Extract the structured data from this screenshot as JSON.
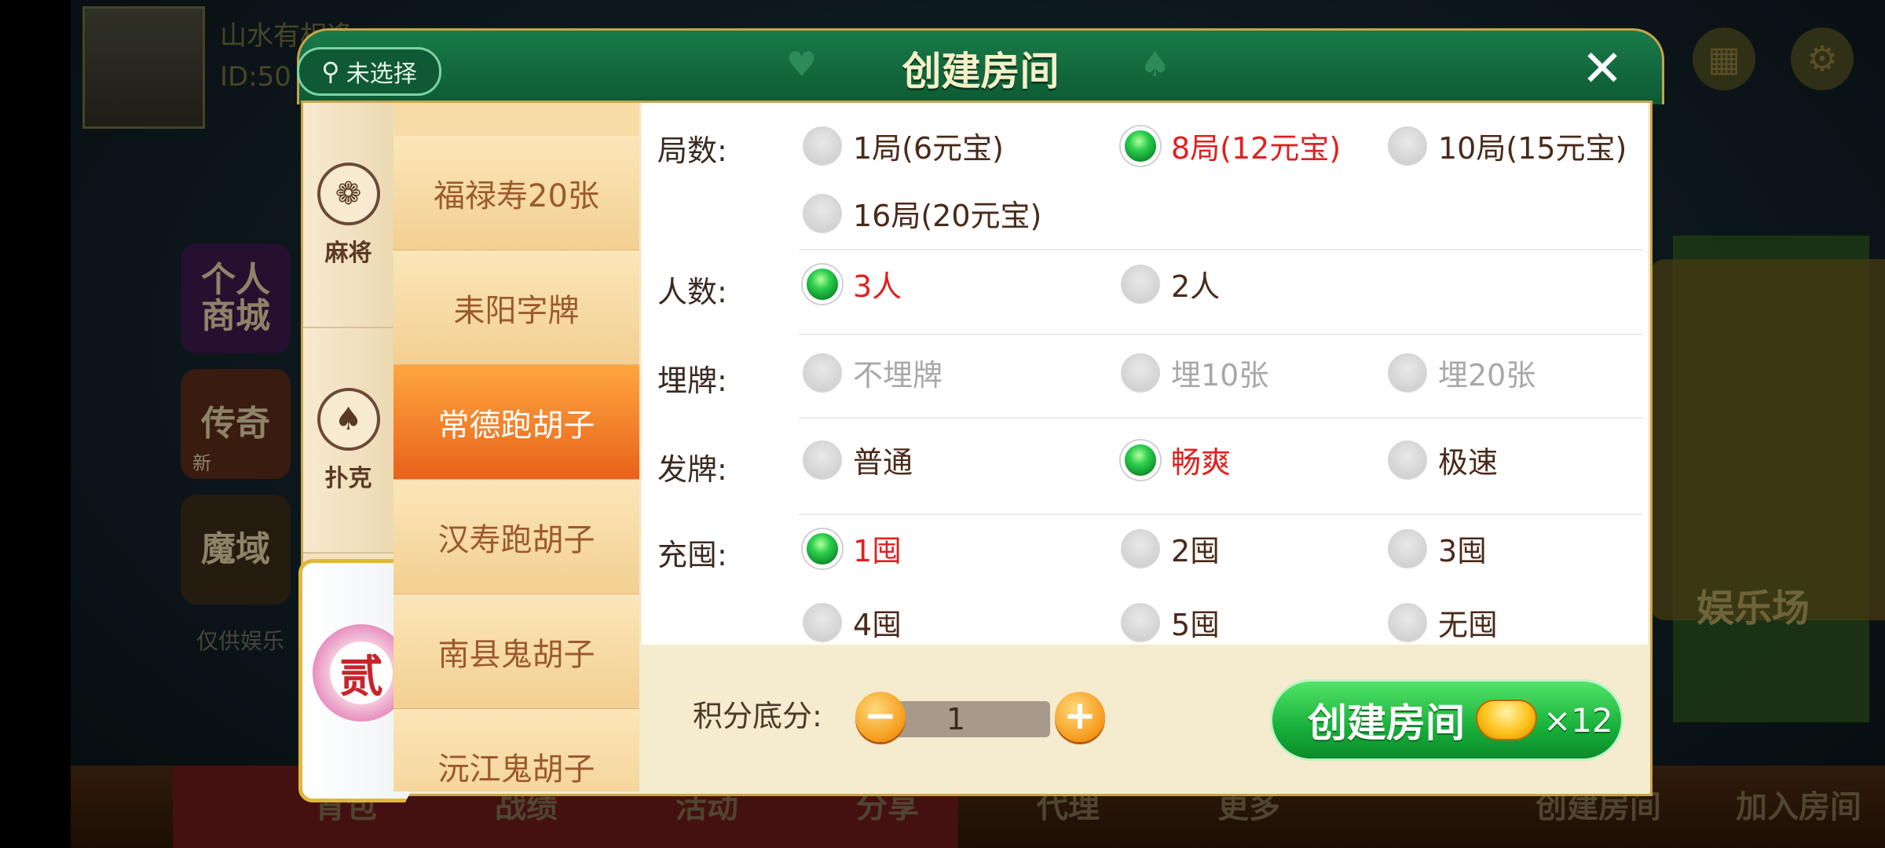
{
  "lobby": {
    "player_name": "山水有相逢",
    "player_id": "ID:50",
    "side_cards": [
      "个人\n商城",
      "传奇",
      "魔域"
    ],
    "side_badge": "新",
    "disclaimer": "仅供娱乐",
    "right_banner": "娱乐场",
    "bottom_bar": [
      "背包",
      "战绩",
      "活动",
      "分享",
      "代理",
      "更多",
      "创建房间",
      "加入房间"
    ]
  },
  "dialog": {
    "title": "创建房间",
    "location": "未选择",
    "close_icon": "close-icon"
  },
  "categories": [
    {
      "label": "麻将",
      "icon": "mahjong-icon"
    },
    {
      "label": "扑克",
      "icon": "spade-icon"
    },
    {
      "label": "贰",
      "icon": "er-badge-icon"
    }
  ],
  "games": [
    "福禄寿20张",
    "耒阳字牌",
    "常德跑胡子",
    "汉寿跑胡子",
    "南县鬼胡子",
    "沅江鬼胡子"
  ],
  "active_game_index": 2,
  "options": {
    "rounds": {
      "label": "局数:",
      "choices": [
        "1局(6元宝)",
        "8局(12元宝)",
        "10局(15元宝)",
        "16局(20元宝)"
      ],
      "selected": 1
    },
    "players": {
      "label": "人数:",
      "choices": [
        "3人",
        "2人"
      ],
      "selected": 0
    },
    "bury": {
      "label": "埋牌:",
      "choices": [
        "不埋牌",
        "埋10张",
        "埋20张"
      ],
      "selected": -1
    },
    "deal": {
      "label": "发牌:",
      "choices": [
        "普通",
        "畅爽",
        "极速"
      ],
      "selected": 1
    },
    "tuo": {
      "label": "充囤:",
      "choices": [
        "1囤",
        "2囤",
        "3囤",
        "4囤",
        "5囤",
        "无囤"
      ],
      "selected": 0
    }
  },
  "score": {
    "label": "积分底分:",
    "value": "1",
    "minus": "−",
    "plus": "+"
  },
  "create_button": {
    "label": "创建房间",
    "cost": "×12"
  },
  "colors": {
    "header_green": "#0c5a33",
    "selected_red": "#e02020",
    "active_orange": "#e8621a",
    "button_green": "#17b03a"
  }
}
